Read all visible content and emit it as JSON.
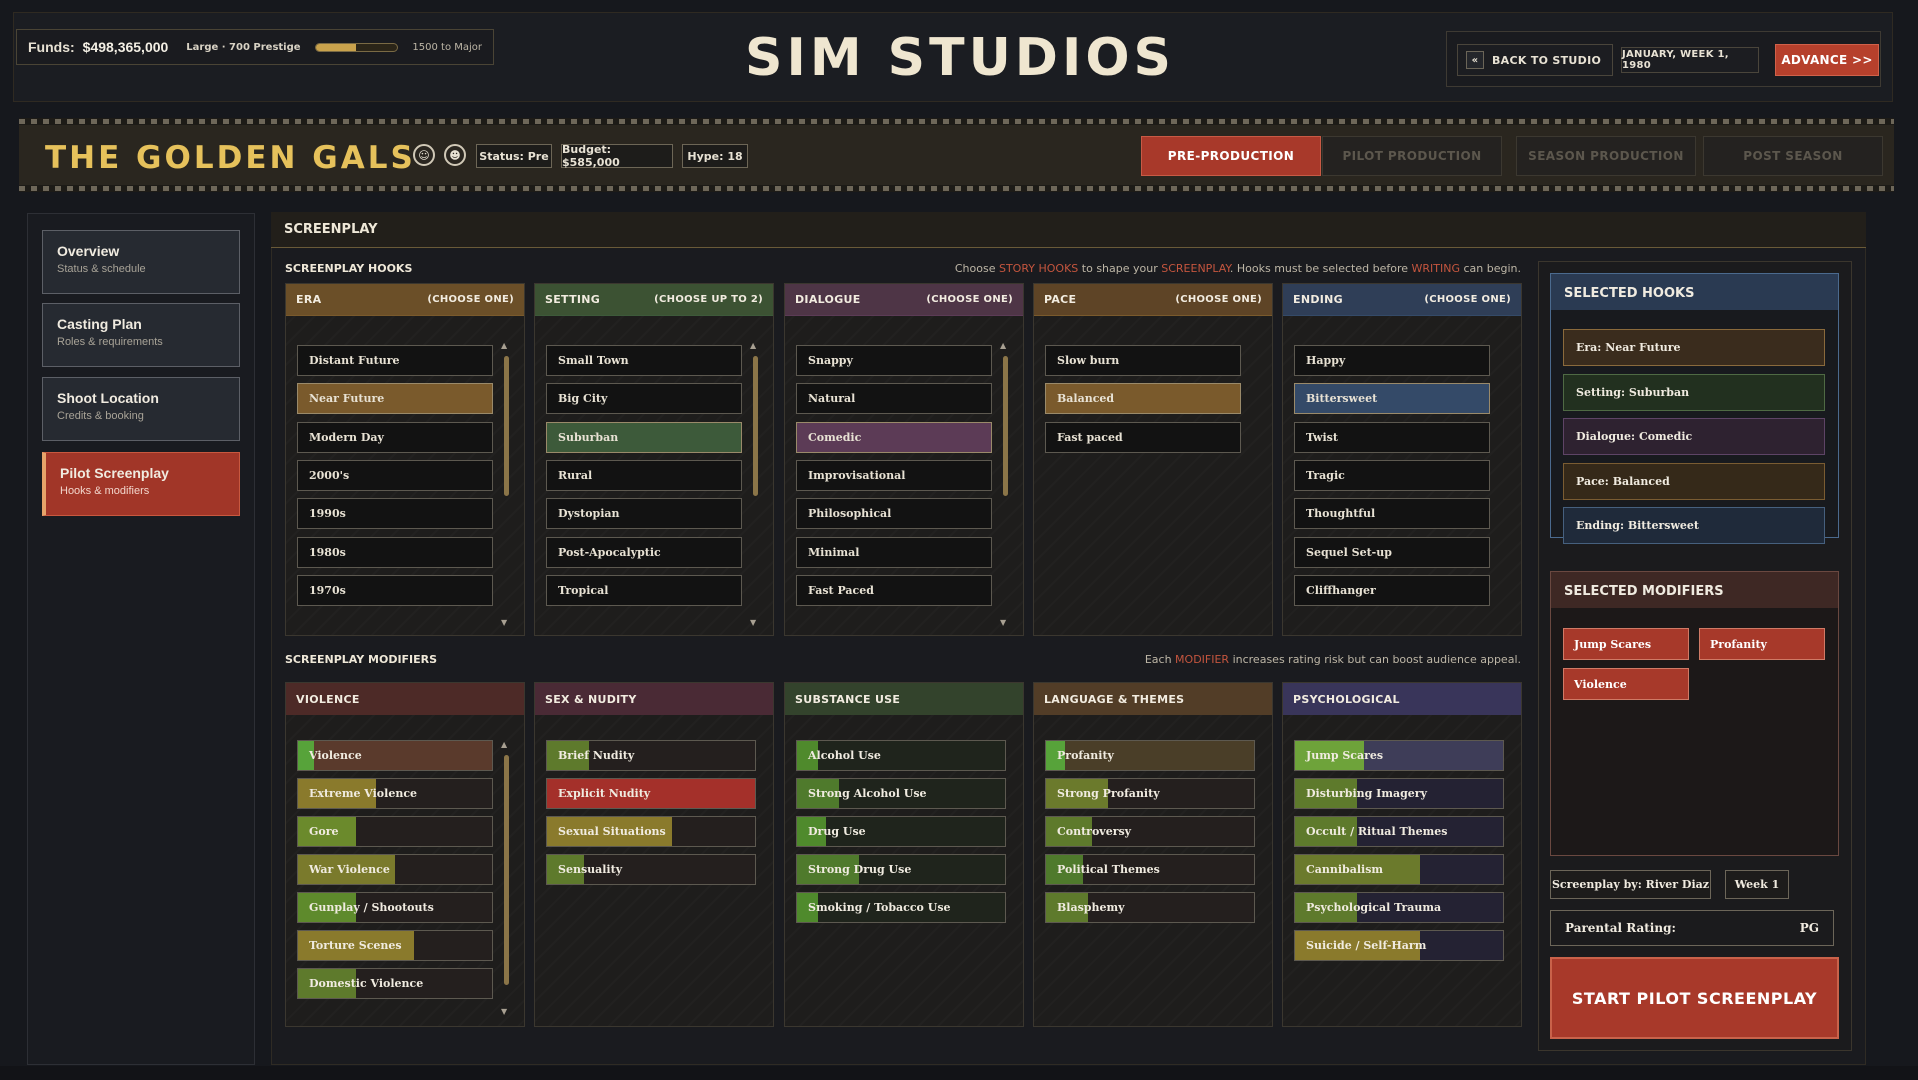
{
  "topbar": {
    "funds_label": "Funds:",
    "funds_value": "$498,365,000",
    "tier": "Large · 700 Prestige",
    "tier_progress": 0.5,
    "next_tier": "1500 to Major",
    "app_title": "SIM STUDIOS",
    "back_label": "BACK TO STUDIO",
    "back_icon": "«",
    "date": "JANUARY, WEEK 1, 1980",
    "advance_label": "ADVANCE >>"
  },
  "show": {
    "title": "THE GOLDEN GALS",
    "status": "Status: Pre",
    "budget": "Budget: $585,000",
    "hype": "Hype: 18",
    "phases": [
      "PRE-PRODUCTION",
      "PILOT PRODUCTION",
      "SEASON PRODUCTION",
      "POST SEASON"
    ],
    "active_phase": 0
  },
  "nav": [
    {
      "title": "Overview",
      "sub": "Status & schedule"
    },
    {
      "title": "Casting Plan",
      "sub": "Roles & requirements"
    },
    {
      "title": "Shoot Location",
      "sub": "Credits & booking"
    },
    {
      "title": "Pilot Screenplay",
      "sub": "Hooks & modifiers"
    }
  ],
  "main": {
    "title": "SCREENPLAY",
    "hooks_title": "SCREENPLAY HOOKS",
    "hooks_hint_1": "Choose ",
    "hooks_hint_hl1": "STORY HOOKS",
    "hooks_hint_2": " to shape your ",
    "hooks_hint_hl2": "SCREENPLAY",
    "hooks_hint_3": ". Hooks must be selected before ",
    "hooks_hint_hl3": "WRITING",
    "hooks_hint_4": " can begin.",
    "modifiers_title": "SCREENPLAY MODIFIERS",
    "mod_hint_1": "Each ",
    "mod_hint_hl": "MODIFIER",
    "mod_hint_2": " increases rating risk but can boost audience appeal."
  },
  "hooks": [
    {
      "name": "ERA",
      "req": "(CHOOSE ONE)",
      "color": "#6b4f28",
      "sel_color": "#7a5a2c",
      "options": [
        "Distant Future",
        "Near Future",
        "Modern Day",
        "2000's",
        "1990s",
        "1980s",
        "1970s"
      ],
      "selected": [
        1
      ],
      "scroll": true
    },
    {
      "name": "SETTING",
      "req": "(CHOOSE UP TO 2)",
      "color": "#3c5233",
      "sel_color": "#3d5a3a",
      "options": [
        "Small Town",
        "Big City",
        "Suburban",
        "Rural",
        "Dystopian",
        "Post-Apocalyptic",
        "Tropical"
      ],
      "selected": [
        2
      ],
      "scroll": true
    },
    {
      "name": "DIALOGUE",
      "req": "(CHOOSE ONE)",
      "color": "#4e3546",
      "sel_color": "#5c3b56",
      "options": [
        "Snappy",
        "Natural",
        "Comedic",
        "Improvisational",
        "Philosophical",
        "Minimal",
        "Fast Paced"
      ],
      "selected": [
        2
      ],
      "scroll": true
    },
    {
      "name": "PACE",
      "req": "(CHOOSE ONE)",
      "color": "#5e4426",
      "sel_color": "#7a5a2c",
      "options": [
        "Slow burn",
        "Balanced",
        "Fast paced"
      ],
      "selected": [
        1
      ],
      "scroll": false
    },
    {
      "name": "ENDING",
      "req": "(CHOOSE ONE)",
      "color": "#2f3e57",
      "sel_color": "#344a68",
      "options": [
        "Happy",
        "Bittersweet",
        "Twist",
        "Tragic",
        "Thoughtful",
        "Sequel Set-up",
        "Cliffhanger"
      ],
      "selected": [
        1
      ],
      "scroll": false
    }
  ],
  "modifiers": [
    {
      "name": "VIOLENCE",
      "color": "#4d2a27",
      "scroll": true,
      "items": [
        {
          "label": "Violence",
          "level": 0.08,
          "fill": "#57a33a",
          "bg": "#5a3a2c"
        },
        {
          "label": "Extreme Violence",
          "level": 0.4,
          "fill": "#8a7a2c",
          "bg": "#241f1e"
        },
        {
          "label": "Gore",
          "level": 0.3,
          "fill": "#6b8a2c",
          "bg": "#241f1e"
        },
        {
          "label": "War Violence",
          "level": 0.5,
          "fill": "#7a7a2c",
          "bg": "#241f1e"
        },
        {
          "label": "Gunplay / Shootouts",
          "level": 0.3,
          "fill": "#5e8a2c",
          "bg": "#241f1e"
        },
        {
          "label": "Torture Scenes",
          "level": 0.6,
          "fill": "#8a7a2c",
          "bg": "#241f1e"
        },
        {
          "label": "Domestic Violence",
          "level": 0.3,
          "fill": "#5e7a2c",
          "bg": "#241f1e"
        }
      ]
    },
    {
      "name": "SEX & NUDITY",
      "color": "#4a2a35",
      "scroll": false,
      "items": [
        {
          "label": "Brief Nudity",
          "level": 0.2,
          "fill": "#5e7a2c",
          "bg": "#241f1e"
        },
        {
          "label": "Explicit Nudity",
          "level": 1.0,
          "fill": "#a4302a",
          "bg": "#a4302a"
        },
        {
          "label": "Sexual Situations",
          "level": 0.6,
          "fill": "#8a7a2c",
          "bg": "#241f1e"
        },
        {
          "label": "Sensuality",
          "level": 0.18,
          "fill": "#5e7a2c",
          "bg": "#241f1e"
        }
      ]
    },
    {
      "name": "SUBSTANCE USE",
      "color": "#33432c",
      "scroll": false,
      "items": [
        {
          "label": "Alcohol Use",
          "level": 0.1,
          "fill": "#4f8a2c",
          "bg": "#1f241c"
        },
        {
          "label": "Strong Alcohol Use",
          "level": 0.2,
          "fill": "#4f7a2c",
          "bg": "#1f241c"
        },
        {
          "label": "Drug Use",
          "level": 0.14,
          "fill": "#4f8a2c",
          "bg": "#1f241c"
        },
        {
          "label": "Strong Drug Use",
          "level": 0.3,
          "fill": "#4f7a2c",
          "bg": "#1f241c"
        },
        {
          "label": "Smoking / Tobacco Use",
          "level": 0.1,
          "fill": "#4f8a2c",
          "bg": "#1f241c"
        }
      ]
    },
    {
      "name": "LANGUAGE & THEMES",
      "color": "#523d27",
      "scroll": false,
      "items": [
        {
          "label": "Profanity",
          "level": 0.09,
          "fill": "#57a33a",
          "bg": "#4a3e28"
        },
        {
          "label": "Strong Profanity",
          "level": 0.3,
          "fill": "#6b7a2c",
          "bg": "#241f1e"
        },
        {
          "label": "Controversy",
          "level": 0.22,
          "fill": "#5e7a2c",
          "bg": "#241f1e"
        },
        {
          "label": "Political Themes",
          "level": 0.18,
          "fill": "#4f7a2c",
          "bg": "#241f1e"
        },
        {
          "label": "Blasphemy",
          "level": 0.2,
          "fill": "#5e7a2c",
          "bg": "#241f1e"
        }
      ]
    },
    {
      "name": "PSYCHOLOGICAL",
      "color": "#39355a",
      "scroll": false,
      "items": [
        {
          "label": "Jump Scares",
          "level": 0.33,
          "fill": "#6ea33a",
          "bg": "#3e3d58"
        },
        {
          "label": "Disturbing Imagery",
          "level": 0.3,
          "fill": "#5e7a2c",
          "bg": "#242233"
        },
        {
          "label": "Occult / Ritual Themes",
          "level": 0.3,
          "fill": "#5e7a2c",
          "bg": "#242233"
        },
        {
          "label": "Cannibalism",
          "level": 0.6,
          "fill": "#6b7a2c",
          "bg": "#242233"
        },
        {
          "label": "Psychological Trauma",
          "level": 0.3,
          "fill": "#5e7a2c",
          "bg": "#242233"
        },
        {
          "label": "Suicide / Self-Harm",
          "level": 0.6,
          "fill": "#8a7a2c",
          "bg": "#242233"
        }
      ]
    }
  ],
  "selected_hooks": {
    "title": "SELECTED HOOKS",
    "items": [
      {
        "label": "Era: Near Future",
        "bg": "#3a2c1d",
        "border": "#8a6a3c"
      },
      {
        "label": "Setting: Suburban",
        "bg": "#22301f",
        "border": "#4f6a44"
      },
      {
        "label": "Dialogue: Comedic",
        "bg": "#2e2230",
        "border": "#5e4466"
      },
      {
        "label": "Pace: Balanced",
        "bg": "#352919",
        "border": "#7a5c32"
      },
      {
        "label": "Ending: Bittersweet",
        "bg": "#1f2a3a",
        "border": "#46607e"
      }
    ]
  },
  "selected_modifiers": {
    "title": "SELECTED MODIFIERS",
    "items": [
      "Jump Scares",
      "Profanity",
      "Violence"
    ]
  },
  "footer": {
    "writer": "Screenplay by: River Diaz",
    "week": "Week 1",
    "rating_label": "Parental Rating:",
    "rating_value": "PG",
    "start_label": "START PILOT SCREENPLAY"
  }
}
